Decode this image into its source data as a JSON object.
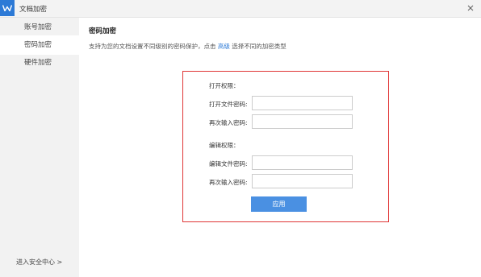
{
  "window": {
    "title": "文档加密",
    "close_icon": "close-icon"
  },
  "sidebar": {
    "items": [
      {
        "label": "账号加密",
        "active": false
      },
      {
        "label": "密码加密",
        "active": true
      },
      {
        "label": "硬件加密",
        "active": false
      }
    ],
    "security_center": "进入安全中心 >"
  },
  "main": {
    "title": "密码加密",
    "description_before": "支持为您的文档设置不同级别的密码保护，点击",
    "description_link": "高级",
    "description_after": "选择不同的加密类型",
    "open_permission": {
      "heading": "打开权限：",
      "password_label": "打开文件密码:",
      "password_value": "",
      "confirm_label": "再次输入密码:",
      "confirm_value": ""
    },
    "edit_permission": {
      "heading": "编辑权限：",
      "password_label": "编辑文件密码:",
      "password_value": "",
      "confirm_label": "再次输入密码:",
      "confirm_value": ""
    },
    "apply_label": "应用"
  },
  "colors": {
    "accent": "#2d7ad6",
    "button": "#4a90e2",
    "highlight_border": "#e03636",
    "sidebar_bg": "#f2f2f2"
  }
}
